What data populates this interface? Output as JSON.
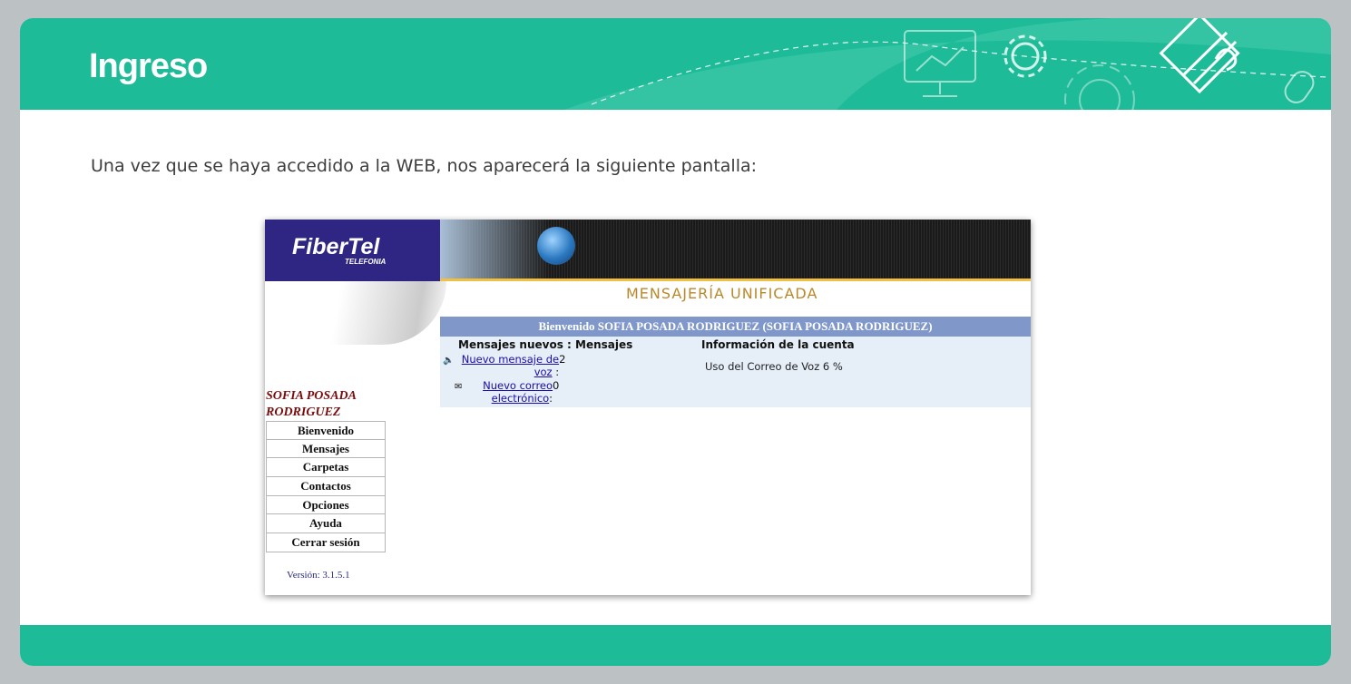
{
  "banner": {
    "title": "Ingreso"
  },
  "intro": "Una vez que se haya accedido a la WEB, nos aparecerá la siguiente pantalla:",
  "app": {
    "logo": "FiberTel",
    "logo_sub": "TELEFONIA",
    "title": "MENSAJERÍA UNIFICADA",
    "welcome": "Bienvenido  SOFIA POSADA RODRIGUEZ  (SOFIA POSADA RODRIGUEZ)",
    "messages_header": "Mensajes nuevos : Mensajes",
    "account_header": "Información de la cuenta",
    "voice_link": "Nuevo mensaje de voz",
    "voice_count": "2",
    "email_link": "Nuevo correo electrónico",
    "email_count": "0",
    "quota": "Uso del Correo de Voz 6 %",
    "user_name": "SOFIA POSADA RODRIGUEZ",
    "nav": [
      "Bienvenido",
      "Mensajes",
      "Carpetas",
      "Contactos",
      "Opciones",
      "Ayuda",
      "Cerrar sesión"
    ],
    "version": "Versión: 3.1.5.1"
  },
  "icons": [
    "slideshow-icon",
    "gear-icon",
    "pencil-diamond-icon",
    "mouse-icon",
    "speaker-icon",
    "envelope-icon",
    "globe-icon"
  ],
  "colors": {
    "banner": "#1dbb98",
    "app_header": "#2f2683",
    "welcome_bar": "#7f97c9",
    "user_name": "#7a0d0d"
  }
}
